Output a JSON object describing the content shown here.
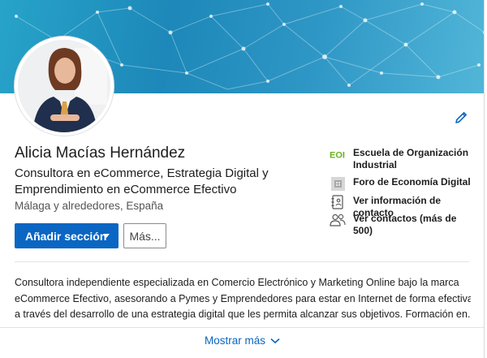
{
  "profile": {
    "name": "Alicia Macías Hernández",
    "headline": "Consultora en eCommerce, Estrategia Digital y Emprendimiento en eCommerce Efectivo",
    "location": "Málaga y alrededores, España"
  },
  "actions": {
    "add_section": "Añadir sección",
    "more": "Más..."
  },
  "sidebar": {
    "items": [
      {
        "label": "Escuela de Organización Industrial",
        "icon": "eoi-logo-icon"
      },
      {
        "label": "Foro de Economía Digital",
        "icon": "company-logo-icon"
      },
      {
        "label": "Ver información de contacto",
        "icon": "contact-card-icon"
      },
      {
        "label": "Ver contactos (más de 500)",
        "icon": "people-icon"
      }
    ],
    "eoi_logo_text": "EOI"
  },
  "about": {
    "lines": [
      "Consultora independiente especializada en Comercio Electrónico y Marketing Online bajo la marca",
      "eCommerce Efectivo, asesorando a Pymes y Emprendedores para estar en Internet de forma efectiva",
      "a través del desarrollo de una estrategia digital que les permita alcanzar sus objetivos. Formación en..."
    ]
  },
  "show_more": "Mostrar más",
  "colors": {
    "accent": "#0a66c2",
    "eoi_green": "#6ab023"
  }
}
